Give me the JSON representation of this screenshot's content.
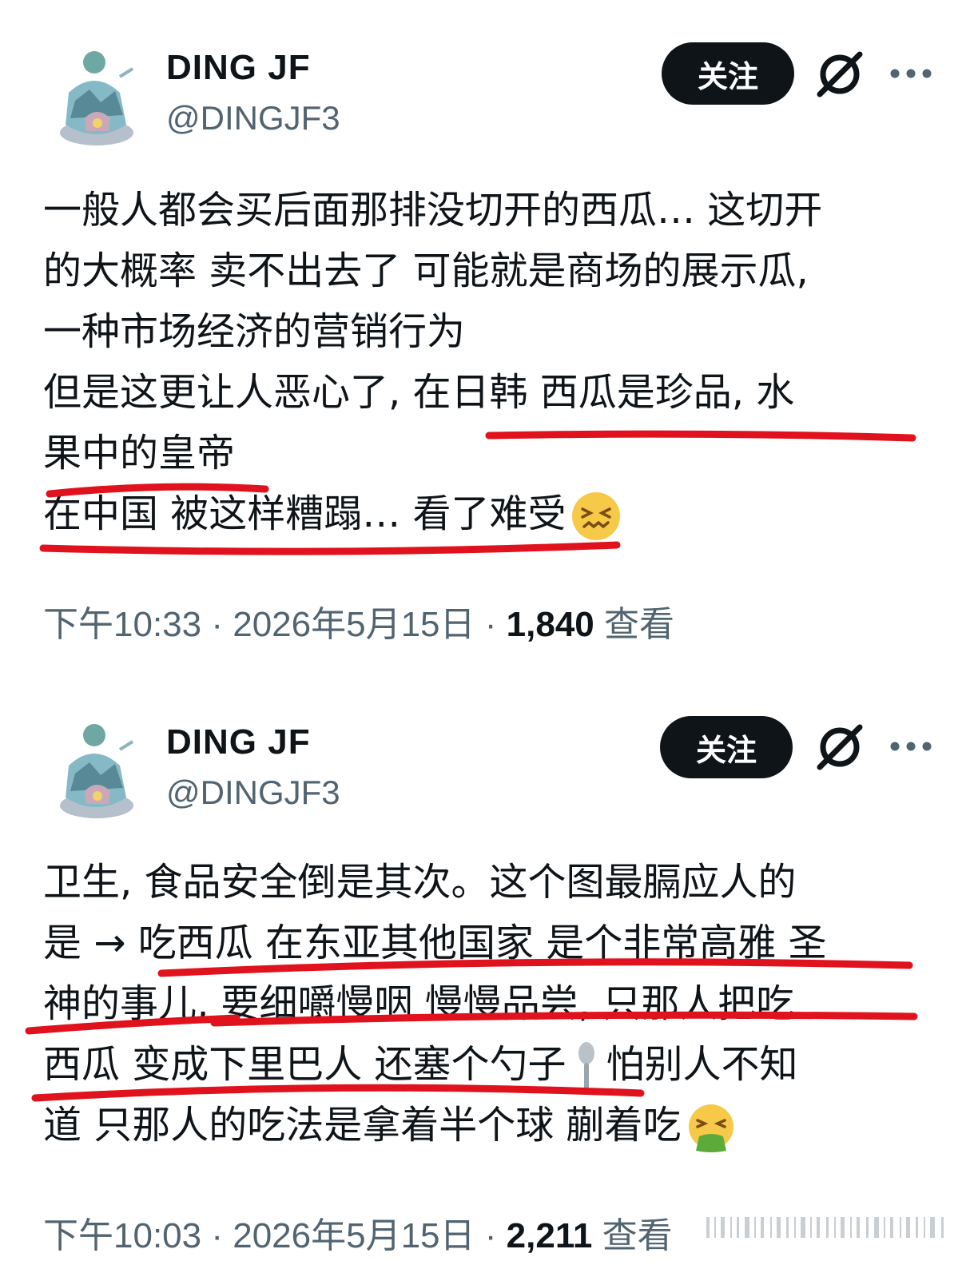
{
  "accent_color": "#0f1419",
  "underline_color": "#e0121e",
  "posts": [
    {
      "author": {
        "name": "DING JF",
        "handle": "@DINGJF3"
      },
      "follow_label": "关注",
      "icons": {
        "grok": "grok-icon",
        "more": "more-icon"
      },
      "lines": [
        "一般人都会买后面那排没切开的西瓜… 这切开",
        "的大概率 卖不出去了 可能就是商场的展示瓜,",
        "一种市场经济的营销行为",
        "但是这更让人恶心了, 在日韩 西瓜是珍品, 水",
        "果中的皇帝",
        "在中国 被这样糟蹋… 看了难受"
      ],
      "emoji": "confounded-face-emoji",
      "meta": {
        "time": "下午10:33",
        "sep": "·",
        "date": "2026年5月15日",
        "views": "1,840",
        "views_label": "查看"
      }
    },
    {
      "author": {
        "name": "DING JF",
        "handle": "@DINGJF3"
      },
      "follow_label": "关注",
      "icons": {
        "grok": "grok-icon",
        "more": "more-icon"
      },
      "lines": [
        "卫生, 食品安全倒是其次。这个图最膈应人的",
        "是 → 吃西瓜 在东亚其他国家 是个非常高雅 圣",
        "神的事儿, 要细嚼慢咽 慢慢品尝, 只那人把吃",
        "西瓜 变成下里巴人 还塞个勺子",
        "怕别人不知",
        "道 只那人的吃法是拿着半个球 蒯着吃"
      ],
      "emoji": "vomiting-face-emoji",
      "meta": {
        "time": "下午10:03",
        "sep": "·",
        "date": "2026年5月15日",
        "views": "2,211",
        "views_label": "查看"
      }
    }
  ]
}
